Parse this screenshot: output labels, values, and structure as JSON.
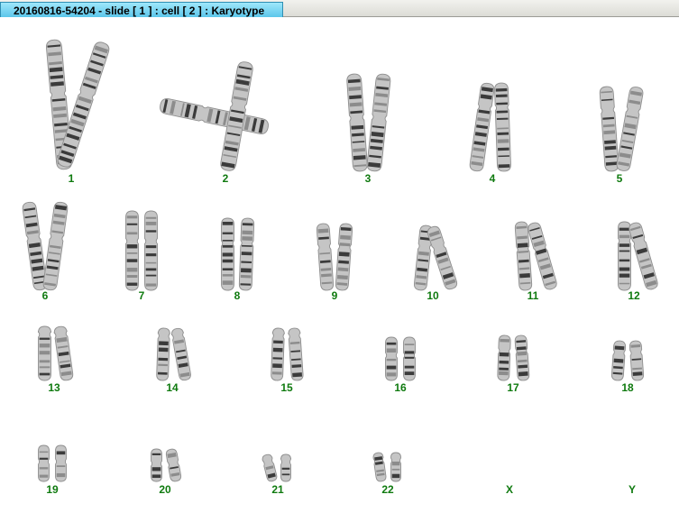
{
  "window": {
    "title": "20160816-54204 - slide [ 1 ] : cell [ 2 ] : Karyotype"
  },
  "karyotype": {
    "label_color": "#0f7a0f",
    "chromosomes": [
      {
        "label": "1",
        "count": 2
      },
      {
        "label": "2",
        "count": 2
      },
      {
        "label": "3",
        "count": 2
      },
      {
        "label": "4",
        "count": 2
      },
      {
        "label": "5",
        "count": 2
      },
      {
        "label": "6",
        "count": 2
      },
      {
        "label": "7",
        "count": 2
      },
      {
        "label": "8",
        "count": 2
      },
      {
        "label": "9",
        "count": 2
      },
      {
        "label": "10",
        "count": 2
      },
      {
        "label": "11",
        "count": 2
      },
      {
        "label": "12",
        "count": 2
      },
      {
        "label": "13",
        "count": 2
      },
      {
        "label": "14",
        "count": 2
      },
      {
        "label": "15",
        "count": 2
      },
      {
        "label": "16",
        "count": 2
      },
      {
        "label": "17",
        "count": 2
      },
      {
        "label": "18",
        "count": 2
      },
      {
        "label": "19",
        "count": 2
      },
      {
        "label": "20",
        "count": 2
      },
      {
        "label": "21",
        "count": 2
      },
      {
        "label": "22",
        "count": 2
      },
      {
        "label": "X",
        "count": 0
      },
      {
        "label": "Y",
        "count": 0
      }
    ]
  }
}
